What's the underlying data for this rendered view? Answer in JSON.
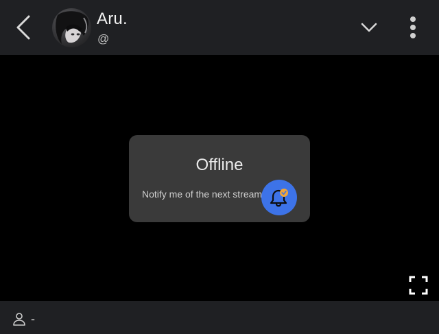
{
  "header": {
    "back_icon": "chevron-left-icon",
    "avatar_alt": "profile-avatar",
    "title": "Aru.",
    "handle": "@",
    "collapse_icon": "chevron-down-icon",
    "menu_icon": "more-vertical-icon"
  },
  "stream": {
    "status_title": "Offline",
    "notify_label": "Notify me of the next stream",
    "notify_icon": "bell-check-icon",
    "fullscreen_icon": "fullscreen-icon"
  },
  "footer": {
    "viewer_icon": "user-icon",
    "viewer_count": "-"
  },
  "colors": {
    "background": "#000000",
    "bar": "#1f2023",
    "card": "#3a3a3a",
    "accent": "#3d73e8",
    "badge": "#f0a53a"
  }
}
